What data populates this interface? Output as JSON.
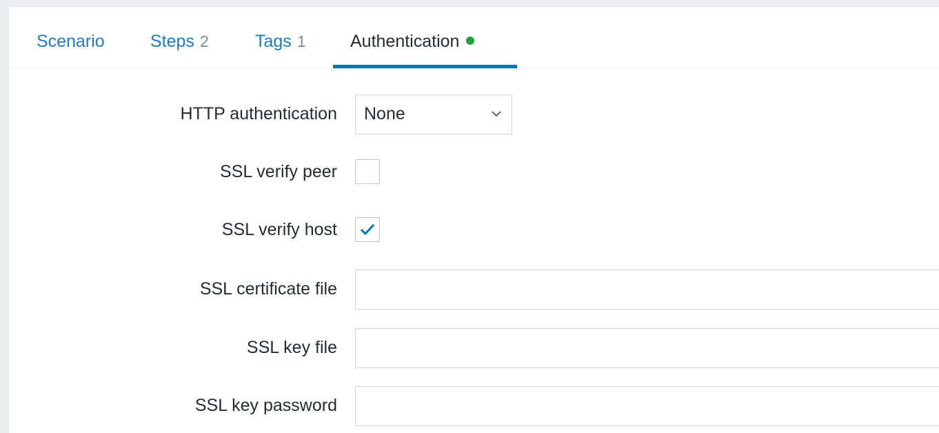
{
  "tabs": [
    {
      "label": "Scenario",
      "count": ""
    },
    {
      "label": "Steps",
      "count": "2"
    },
    {
      "label": "Tags",
      "count": "1"
    },
    {
      "label": "Authentication",
      "count": ""
    }
  ],
  "active_tab": "Authentication",
  "colors": {
    "link": "#1f7ac5",
    "active_underline": "#0275b8",
    "status_dot": "#1fa334"
  },
  "form": {
    "http_auth": {
      "label": "HTTP authentication",
      "value": "None"
    },
    "ssl_verify_peer": {
      "label": "SSL verify peer",
      "checked": false
    },
    "ssl_verify_host": {
      "label": "SSL verify host",
      "checked": true
    },
    "ssl_cert_file": {
      "label": "SSL certificate file",
      "value": ""
    },
    "ssl_key_file": {
      "label": "SSL key file",
      "value": ""
    },
    "ssl_key_password": {
      "label": "SSL key password",
      "value": ""
    }
  }
}
